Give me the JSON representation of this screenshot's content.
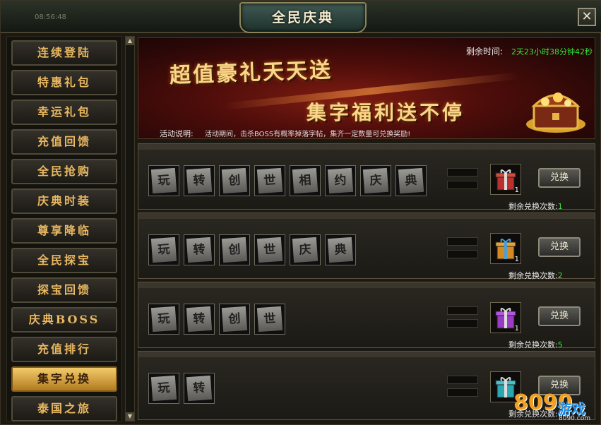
{
  "window": {
    "title": "全民庆典",
    "close_label": "✕",
    "background_time": "08:56:48"
  },
  "sidebar": {
    "items": [
      {
        "label": "连续登陆",
        "active": false
      },
      {
        "label": "特惠礼包",
        "active": false
      },
      {
        "label": "幸运礼包",
        "active": false
      },
      {
        "label": "充值回馈",
        "active": false
      },
      {
        "label": "全民抢购",
        "active": false
      },
      {
        "label": "庆典时装",
        "active": false
      },
      {
        "label": "尊享降临",
        "active": false
      },
      {
        "label": "全民探宝",
        "active": false
      },
      {
        "label": "探宝回馈",
        "active": false
      },
      {
        "label": "庆典BOSS",
        "active": false
      },
      {
        "label": "充值排行",
        "active": false
      },
      {
        "label": "集字兑换",
        "active": true
      },
      {
        "label": "泰国之旅",
        "active": false
      }
    ]
  },
  "banner": {
    "remaining_label": "剩余时间:",
    "remaining_value": "2天23小时38分钟42秒",
    "slogan_line1": "超值豪礼天天送",
    "slogan_line2": "集字福利送不停",
    "desc_label": "活动说明:",
    "desc_text": "活动期间，击杀BOSS有概率掉落字帖，集齐一定数量可兑换奖励!"
  },
  "exchange_rows": [
    {
      "chars": [
        "玩",
        "转",
        "创",
        "世",
        "相",
        "约",
        "庆",
        "典"
      ],
      "gift_count": "1",
      "gift_color": "#b8312c",
      "button": "兑换",
      "remaining_label": "剩余兑换次数:",
      "remaining": "1"
    },
    {
      "chars": [
        "玩",
        "转",
        "创",
        "世",
        "庆",
        "典"
      ],
      "gift_count": "1",
      "gift_color": "#d48a1e",
      "button": "兑换",
      "remaining_label": "剩余兑换次数:",
      "remaining": "2"
    },
    {
      "chars": [
        "玩",
        "转",
        "创",
        "世"
      ],
      "gift_count": "1",
      "gift_color": "#9a3bc4",
      "button": "兑换",
      "remaining_label": "剩余兑换次数:",
      "remaining": "5"
    },
    {
      "chars": [
        "玩",
        "转"
      ],
      "gift_count": "",
      "gift_color": "#2aa7b0",
      "button": "兑换",
      "remaining_label": "剩余兑换次数:",
      "remaining": ""
    }
  ],
  "watermark": {
    "brand_number": "8090",
    "brand_text": "游戏",
    "url": "8090.com"
  }
}
